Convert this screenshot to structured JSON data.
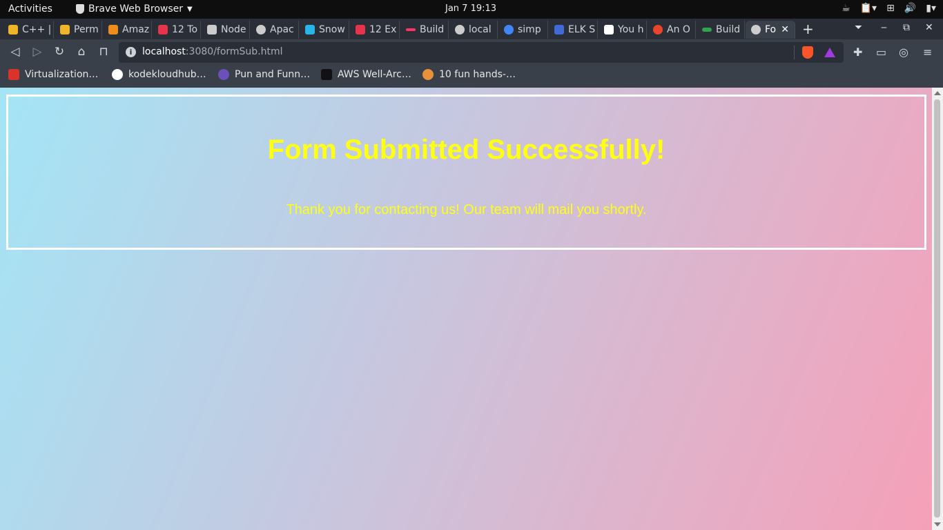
{
  "topbar": {
    "activities": "Activities",
    "app_name": "Brave Web Browser",
    "clock": "Jan 7  19:13"
  },
  "tabs": [
    {
      "label": "C++ |",
      "icon_color": "#f0b429"
    },
    {
      "label": "Perm",
      "icon_color": "#f0b429"
    },
    {
      "label": "Amaz",
      "icon_color": "#f08c1a"
    },
    {
      "label": "12 To",
      "icon_color": "#e8344a"
    },
    {
      "label": "Node",
      "icon_color": "#cccccc"
    },
    {
      "label": "Apac",
      "icon_color": "#cccccc"
    },
    {
      "label": "Snow",
      "icon_color": "#29b5e8"
    },
    {
      "label": "12 Ex",
      "icon_color": "#e8344a"
    },
    {
      "label": "Build",
      "icon_color": "#ff3366"
    },
    {
      "label": "local",
      "icon_color": "#cccccc"
    },
    {
      "label": "simp",
      "icon_color": "#4285f4"
    },
    {
      "label": "ELK S",
      "icon_color": "#3f6ad8"
    },
    {
      "label": "You h",
      "icon_color": "#ffffff"
    },
    {
      "label": "An O",
      "icon_color": "#e8452c"
    },
    {
      "label": "Build",
      "icon_color": "#2ea44f"
    },
    {
      "label": "Fo",
      "icon_color": "#cccccc",
      "active": true
    }
  ],
  "toolbar": {
    "url_host": "localhost",
    "url_rest": ":3080/formSub.html"
  },
  "bookmarks": [
    {
      "label": "Virtualization…",
      "icon_color": "#d9342b"
    },
    {
      "label": "kodekloudhub…",
      "icon_color": "#ffffff"
    },
    {
      "label": "Pun and Funn…",
      "icon_color": "#6b4fbb"
    },
    {
      "label": "AWS Well-Arc…",
      "icon_color": "#111111"
    },
    {
      "label": "10 fun hands-…",
      "icon_color": "#e8913a"
    }
  ],
  "page": {
    "heading": "Form Submitted Successfully!",
    "message": "Thank you for contacting us! Our team will mail you shortly.",
    "text_color": "#ffff14",
    "border_color": "#ffffff"
  }
}
